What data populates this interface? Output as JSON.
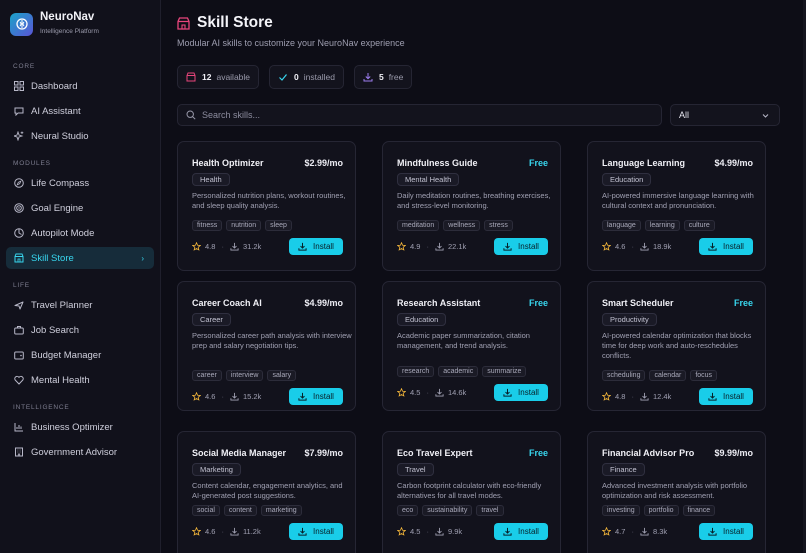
{
  "brand": {
    "name": "NeuroNav",
    "subtitle": "Intelligence Platform"
  },
  "sidebar": {
    "sections": [
      {
        "title": "CORE",
        "items": [
          {
            "label": "Dashboard",
            "icon": "grid-icon"
          },
          {
            "label": "AI Assistant",
            "icon": "chat-icon"
          },
          {
            "label": "Neural Studio",
            "icon": "sparkles-icon"
          }
        ]
      },
      {
        "title": "MODULES",
        "items": [
          {
            "label": "Life Compass",
            "icon": "compass-icon"
          },
          {
            "label": "Goal Engine",
            "icon": "target-icon"
          },
          {
            "label": "Autopilot Mode",
            "icon": "autopilot-icon"
          },
          {
            "label": "Skill Store",
            "icon": "store-icon",
            "active": true
          }
        ]
      },
      {
        "title": "LIFE",
        "items": [
          {
            "label": "Travel Planner",
            "icon": "plane-icon"
          },
          {
            "label": "Job Search",
            "icon": "briefcase-icon"
          },
          {
            "label": "Budget Manager",
            "icon": "wallet-icon"
          },
          {
            "label": "Mental Health",
            "icon": "heart-icon"
          }
        ]
      },
      {
        "title": "INTELLIGENCE",
        "items": [
          {
            "label": "Business Optimizer",
            "icon": "chart-icon"
          },
          {
            "label": "Government Advisor",
            "icon": "building-icon"
          }
        ]
      }
    ]
  },
  "page": {
    "title": "Skill Store",
    "subtitle": "Modular AI skills to customize your NeuroNav experience"
  },
  "stats": {
    "available": {
      "count": "12",
      "label": "available"
    },
    "installed": {
      "count": "0",
      "label": "installed"
    },
    "free": {
      "count": "5",
      "label": "free"
    }
  },
  "search": {
    "placeholder": "Search skills...",
    "value": ""
  },
  "filter": {
    "selected": "All"
  },
  "install_label": "Install",
  "skills": [
    {
      "name": "Health Optimizer",
      "price": "$2.99/mo",
      "category": "Health",
      "description": "Personalized nutrition plans, workout routines, and sleep quality analysis.",
      "tags": [
        "fitness",
        "nutrition",
        "sleep"
      ],
      "rating": "4.8",
      "downloads": "31.2k"
    },
    {
      "name": "Mindfulness Guide",
      "price": "Free",
      "category": "Mental Health",
      "description": "Daily meditation routines, breathing exercises, and stress-level monitoring.",
      "tags": [
        "meditation",
        "wellness",
        "stress"
      ],
      "rating": "4.9",
      "downloads": "22.1k"
    },
    {
      "name": "Language Learning",
      "price": "$4.99/mo",
      "category": "Education",
      "description": "AI-powered immersive language learning with cultural context and pronunciation.",
      "tags": [
        "language",
        "learning",
        "culture"
      ],
      "rating": "4.6",
      "downloads": "18.9k"
    },
    {
      "name": "Career Coach AI",
      "price": "$4.99/mo",
      "category": "Career",
      "description": "Personalized career path analysis with interview prep and salary negotiation tips.",
      "tags": [
        "career",
        "interview",
        "salary"
      ],
      "rating": "4.6",
      "downloads": "15.2k"
    },
    {
      "name": "Research Assistant",
      "price": "Free",
      "category": "Education",
      "description": "Academic paper summarization, citation management, and trend analysis.",
      "tags": [
        "research",
        "academic",
        "summarize"
      ],
      "rating": "4.5",
      "downloads": "14.6k"
    },
    {
      "name": "Smart Scheduler",
      "price": "Free",
      "category": "Productivity",
      "description": "AI-powered calendar optimization that blocks time for deep work and auto-reschedules conflicts.",
      "tags": [
        "scheduling",
        "calendar",
        "focus"
      ],
      "rating": "4.8",
      "downloads": "12.4k"
    },
    {
      "name": "Social Media Manager",
      "price": "$7.99/mo",
      "category": "Marketing",
      "description": "Content calendar, engagement analytics, and AI-generated post suggestions.",
      "tags": [
        "social",
        "content",
        "marketing"
      ],
      "rating": "4.6",
      "downloads": "11.2k"
    },
    {
      "name": "Eco Travel Expert",
      "price": "Free",
      "category": "Travel",
      "description": "Carbon footprint calculator with eco-friendly alternatives for all travel modes.",
      "tags": [
        "eco",
        "sustainability",
        "travel"
      ],
      "rating": "4.5",
      "downloads": "9.9k"
    },
    {
      "name": "Financial Advisor Pro",
      "price": "$9.99/mo",
      "category": "Finance",
      "description": "Advanced investment analysis with portfolio optimization and risk assessment.",
      "tags": [
        "investing",
        "portfolio",
        "finance"
      ],
      "rating": "4.7",
      "downloads": "8.3k"
    }
  ],
  "colors": {
    "accent": "#19cde9",
    "store_icon": "#e8457c",
    "star": "#f2b53a",
    "background": "#0d0d16"
  }
}
